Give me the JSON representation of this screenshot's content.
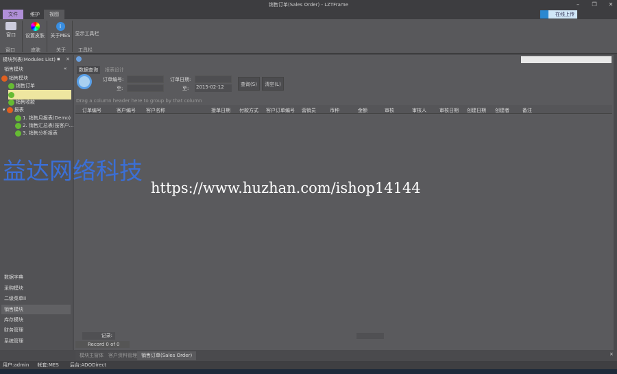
{
  "title": "销售订单(Sales Order) - LZTFrame",
  "ribbon": {
    "tabs": [
      "文件",
      "维护",
      "视图"
    ],
    "buttons": [
      "窗口",
      "设置皮肤",
      "关于MES",
      "显示工具栏"
    ],
    "groups": [
      "窗口",
      "皮肤",
      "关于",
      "工具栏"
    ],
    "upload": "在线上传"
  },
  "left": {
    "title": "模块列表(Modules List)",
    "section": "销售模块",
    "tree": [
      {
        "label": "销售模块"
      },
      {
        "label": "销售订单"
      },
      {
        "label": ""
      },
      {
        "label": "销售收款"
      },
      {
        "label": "报表"
      },
      {
        "label": "1. 销售月报表(Demo)"
      },
      {
        "label": "2. 销售汇总表(按客户..."
      },
      {
        "label": "3. 销售分析报表"
      }
    ],
    "modules": [
      "数据字典",
      "采购模块",
      "二级菜单II",
      "销售模块",
      "库存模块",
      "财务管理",
      "系统管理"
    ]
  },
  "main": {
    "tabs": [
      "数据查询",
      "报表设计"
    ],
    "order_no_label": "订单编号:",
    "to_label": "至:",
    "order_date_label": "订单日期:",
    "date_to": "2015-02-12",
    "query": "查询(S)",
    "clear": "清空(L)",
    "group_hint": "Drag a column header here to group by that column",
    "columns": [
      "订单编号",
      "客户编号",
      "客户名称",
      "接单日期",
      "付款方式",
      "客户订单编号",
      "营销员",
      "币种",
      "金额",
      "审核",
      "审核人",
      "审核日期",
      "创建日期",
      "创建者",
      "备注"
    ],
    "records_label": "记录:",
    "record_nav": "Record 0 of 0"
  },
  "bottom_tabs": [
    "模块主窗体",
    "客户资料管理",
    "销售订单(Sales Order)"
  ],
  "status": [
    "用户:admin",
    "帐套:MES",
    "后台:ADODirect"
  ],
  "watermark": {
    "cn": "益达网络科技",
    "url": "https://www.huzhan.com/ishop14144"
  }
}
